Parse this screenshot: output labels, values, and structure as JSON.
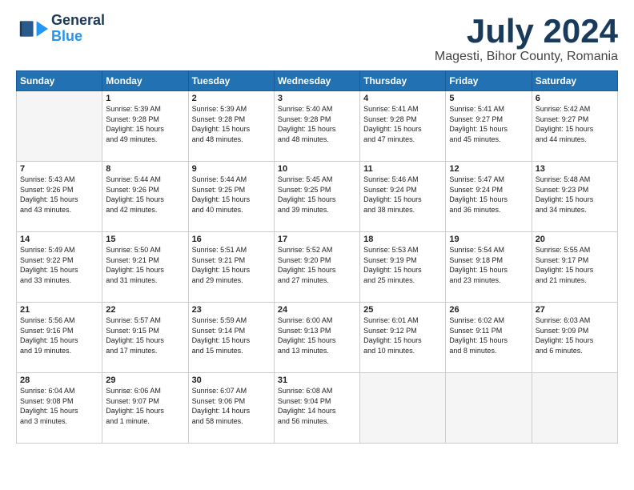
{
  "header": {
    "logo_general": "General",
    "logo_blue": "Blue",
    "month_title": "July 2024",
    "subtitle": "Magesti, Bihor County, Romania"
  },
  "columns": [
    "Sunday",
    "Monday",
    "Tuesday",
    "Wednesday",
    "Thursday",
    "Friday",
    "Saturday"
  ],
  "weeks": [
    [
      {
        "day": "",
        "text": ""
      },
      {
        "day": "1",
        "text": "Sunrise: 5:39 AM\nSunset: 9:28 PM\nDaylight: 15 hours\nand 49 minutes."
      },
      {
        "day": "2",
        "text": "Sunrise: 5:39 AM\nSunset: 9:28 PM\nDaylight: 15 hours\nand 48 minutes."
      },
      {
        "day": "3",
        "text": "Sunrise: 5:40 AM\nSunset: 9:28 PM\nDaylight: 15 hours\nand 48 minutes."
      },
      {
        "day": "4",
        "text": "Sunrise: 5:41 AM\nSunset: 9:28 PM\nDaylight: 15 hours\nand 47 minutes."
      },
      {
        "day": "5",
        "text": "Sunrise: 5:41 AM\nSunset: 9:27 PM\nDaylight: 15 hours\nand 45 minutes."
      },
      {
        "day": "6",
        "text": "Sunrise: 5:42 AM\nSunset: 9:27 PM\nDaylight: 15 hours\nand 44 minutes."
      }
    ],
    [
      {
        "day": "7",
        "text": "Sunrise: 5:43 AM\nSunset: 9:26 PM\nDaylight: 15 hours\nand 43 minutes."
      },
      {
        "day": "8",
        "text": "Sunrise: 5:44 AM\nSunset: 9:26 PM\nDaylight: 15 hours\nand 42 minutes."
      },
      {
        "day": "9",
        "text": "Sunrise: 5:44 AM\nSunset: 9:25 PM\nDaylight: 15 hours\nand 40 minutes."
      },
      {
        "day": "10",
        "text": "Sunrise: 5:45 AM\nSunset: 9:25 PM\nDaylight: 15 hours\nand 39 minutes."
      },
      {
        "day": "11",
        "text": "Sunrise: 5:46 AM\nSunset: 9:24 PM\nDaylight: 15 hours\nand 38 minutes."
      },
      {
        "day": "12",
        "text": "Sunrise: 5:47 AM\nSunset: 9:24 PM\nDaylight: 15 hours\nand 36 minutes."
      },
      {
        "day": "13",
        "text": "Sunrise: 5:48 AM\nSunset: 9:23 PM\nDaylight: 15 hours\nand 34 minutes."
      }
    ],
    [
      {
        "day": "14",
        "text": "Sunrise: 5:49 AM\nSunset: 9:22 PM\nDaylight: 15 hours\nand 33 minutes."
      },
      {
        "day": "15",
        "text": "Sunrise: 5:50 AM\nSunset: 9:21 PM\nDaylight: 15 hours\nand 31 minutes."
      },
      {
        "day": "16",
        "text": "Sunrise: 5:51 AM\nSunset: 9:21 PM\nDaylight: 15 hours\nand 29 minutes."
      },
      {
        "day": "17",
        "text": "Sunrise: 5:52 AM\nSunset: 9:20 PM\nDaylight: 15 hours\nand 27 minutes."
      },
      {
        "day": "18",
        "text": "Sunrise: 5:53 AM\nSunset: 9:19 PM\nDaylight: 15 hours\nand 25 minutes."
      },
      {
        "day": "19",
        "text": "Sunrise: 5:54 AM\nSunset: 9:18 PM\nDaylight: 15 hours\nand 23 minutes."
      },
      {
        "day": "20",
        "text": "Sunrise: 5:55 AM\nSunset: 9:17 PM\nDaylight: 15 hours\nand 21 minutes."
      }
    ],
    [
      {
        "day": "21",
        "text": "Sunrise: 5:56 AM\nSunset: 9:16 PM\nDaylight: 15 hours\nand 19 minutes."
      },
      {
        "day": "22",
        "text": "Sunrise: 5:57 AM\nSunset: 9:15 PM\nDaylight: 15 hours\nand 17 minutes."
      },
      {
        "day": "23",
        "text": "Sunrise: 5:59 AM\nSunset: 9:14 PM\nDaylight: 15 hours\nand 15 minutes."
      },
      {
        "day": "24",
        "text": "Sunrise: 6:00 AM\nSunset: 9:13 PM\nDaylight: 15 hours\nand 13 minutes."
      },
      {
        "day": "25",
        "text": "Sunrise: 6:01 AM\nSunset: 9:12 PM\nDaylight: 15 hours\nand 10 minutes."
      },
      {
        "day": "26",
        "text": "Sunrise: 6:02 AM\nSunset: 9:11 PM\nDaylight: 15 hours\nand 8 minutes."
      },
      {
        "day": "27",
        "text": "Sunrise: 6:03 AM\nSunset: 9:09 PM\nDaylight: 15 hours\nand 6 minutes."
      }
    ],
    [
      {
        "day": "28",
        "text": "Sunrise: 6:04 AM\nSunset: 9:08 PM\nDaylight: 15 hours\nand 3 minutes."
      },
      {
        "day": "29",
        "text": "Sunrise: 6:06 AM\nSunset: 9:07 PM\nDaylight: 15 hours\nand 1 minute."
      },
      {
        "day": "30",
        "text": "Sunrise: 6:07 AM\nSunset: 9:06 PM\nDaylight: 14 hours\nand 58 minutes."
      },
      {
        "day": "31",
        "text": "Sunrise: 6:08 AM\nSunset: 9:04 PM\nDaylight: 14 hours\nand 56 minutes."
      },
      {
        "day": "",
        "text": ""
      },
      {
        "day": "",
        "text": ""
      },
      {
        "day": "",
        "text": ""
      }
    ]
  ]
}
